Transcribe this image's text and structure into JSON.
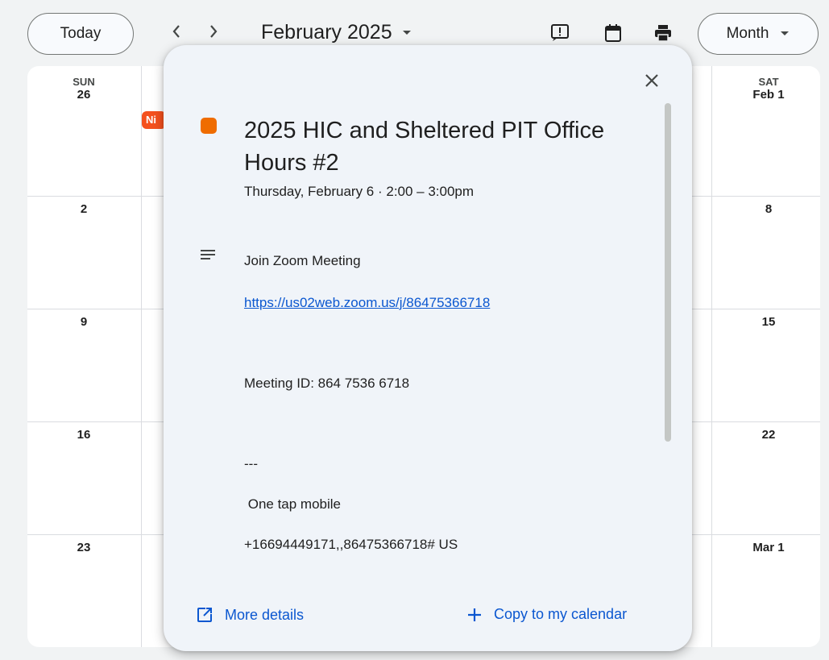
{
  "toolbar": {
    "today_label": "Today",
    "prev_icon": "chevron-left-icon",
    "next_icon": "chevron-right-icon",
    "prev_glyph": "‹",
    "next_glyph": "›",
    "month_title": "February 2025",
    "view_label": "Month"
  },
  "calendar": {
    "header": [
      {
        "dow": "SUN",
        "date": "26"
      },
      {
        "dow": "SAT",
        "date": "Feb 1"
      }
    ],
    "left_dates": [
      "2",
      "9",
      "16",
      "23"
    ],
    "right_dates": [
      "8",
      "15",
      "22",
      "Mar 1"
    ],
    "chip_text": "Ni",
    "chip_color": "#f4511e"
  },
  "event": {
    "title": "2025 HIC and Sheltered PIT Office Hours #2",
    "time": "Thursday, February 6  ·  2:00 – 3:00pm",
    "color": "#ef6c00",
    "description": {
      "line1": "Join Zoom Meeting",
      "link": "https://us02web.zoom.us/j/86475366718",
      "meeting_id": "Meeting ID: 864 7536 6718",
      "separator": "---",
      "one_tap": " One tap mobile",
      "phone": "+16694449171,,86475366718# US"
    },
    "more_details_label": "More details",
    "copy_label": "Copy to my calendar"
  },
  "colors": {
    "accent": "#0b57d0",
    "popup_bg": "#f0f4f9"
  }
}
